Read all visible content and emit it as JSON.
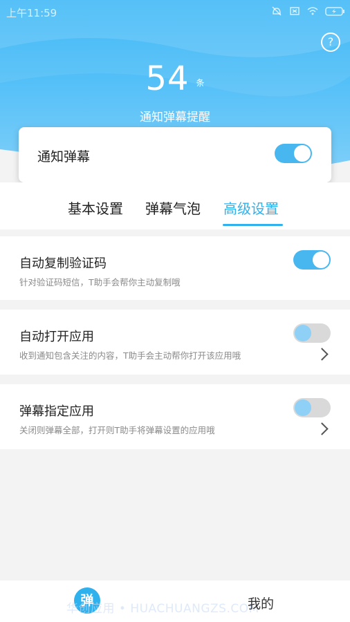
{
  "status_bar": {
    "time": "上午11:59"
  },
  "header": {
    "count": "54",
    "count_unit": "条",
    "subtitle": "通知弹幕提醒",
    "help_symbol": "?",
    "colors": {
      "hero_top": "#36b5f5",
      "hero_bottom": "#8ed5fb"
    }
  },
  "main_toggle": {
    "label": "通知弹幕",
    "on": true
  },
  "tabs": [
    {
      "label": "基本设置",
      "active": false
    },
    {
      "label": "弹幕气泡",
      "active": false
    },
    {
      "label": "高级设置",
      "active": true
    }
  ],
  "settings": [
    {
      "title": "自动复制验证码",
      "description": "针对验证码短信，T助手会帮你主动复制哦",
      "on": true,
      "has_arrow": false
    },
    {
      "title": "自动打开应用",
      "description": "收到通知包含关注的内容，T助手会主动帮你打开该应用哦",
      "on": false,
      "has_arrow": true
    },
    {
      "title": "弹幕指定应用",
      "description": "关闭则弹幕全部，打开则T助手将弹幕设置的应用哦",
      "on": false,
      "has_arrow": true
    }
  ],
  "bottom_nav": {
    "tab_icon_char": "弹",
    "tab_mine": "我的",
    "watermark": "华创应用 • HUACHUANGZS.COM"
  },
  "accent_color": "#2fb1ee"
}
